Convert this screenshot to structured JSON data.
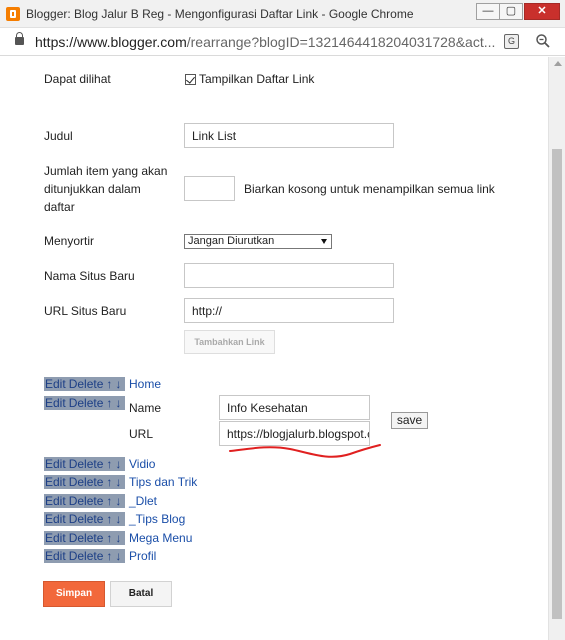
{
  "window": {
    "title": "Blogger: Blog Jalur B Reg - Mengonfigurasi Daftar Link - Google Chrome",
    "min_symbol": "—",
    "max_symbol": "▢",
    "close_symbol": "✕"
  },
  "address": {
    "host": "https://www.blogger.com",
    "path": "/rearrange?blogID=1321464418204031728&act..."
  },
  "icons": {
    "app": "blogger-icon",
    "lock": "lock-icon",
    "translate": "translate-icon",
    "zoom": "zoom-icon"
  },
  "form": {
    "visible_label": "Dapat dilihat",
    "visible_checkbox_label": "Tampilkan Daftar Link",
    "title_label": "Judul",
    "title_value": "Link List",
    "count_label_1": "Jumlah item yang akan",
    "count_label_2": "ditunjukkan dalam",
    "count_label_3": "daftar",
    "count_value": "",
    "count_hint": "Biarkan kosong untuk menampilkan semua link",
    "sort_label": "Menyortir",
    "sort_value": "Jangan Diurutkan",
    "new_site_name_label": "Nama Situs Baru",
    "new_site_name_value": "",
    "new_site_url_label": "URL Situs Baru",
    "new_site_url_value": "http://",
    "add_link_button": "Tambahkan Link"
  },
  "links": {
    "action_edit": "Edit",
    "action_delete": "Delete",
    "action_up": "↑",
    "action_down": "↓",
    "items": [
      {
        "name": "Home"
      },
      {
        "name": ""
      },
      {
        "name": "Vidio"
      },
      {
        "name": "Tips dan Trik"
      },
      {
        "name": "_Dlet"
      },
      {
        "name": "_Tips Blog"
      },
      {
        "name": "Mega Menu"
      },
      {
        "name": "Profil"
      }
    ],
    "editor": {
      "name_label": "Name",
      "name_value": "Info Kesehatan",
      "url_label": "URL",
      "url_value": "https://blogjalurb.blogspot.c",
      "save_label": "save"
    }
  },
  "footer": {
    "save_button": "Simpan",
    "cancel_button": "Batal"
  },
  "colors": {
    "primary_button": "#f2683b",
    "link_text": "#1a4ea8",
    "action_highlight": "#8e9cb0",
    "annotation_underline": "#e02020"
  }
}
